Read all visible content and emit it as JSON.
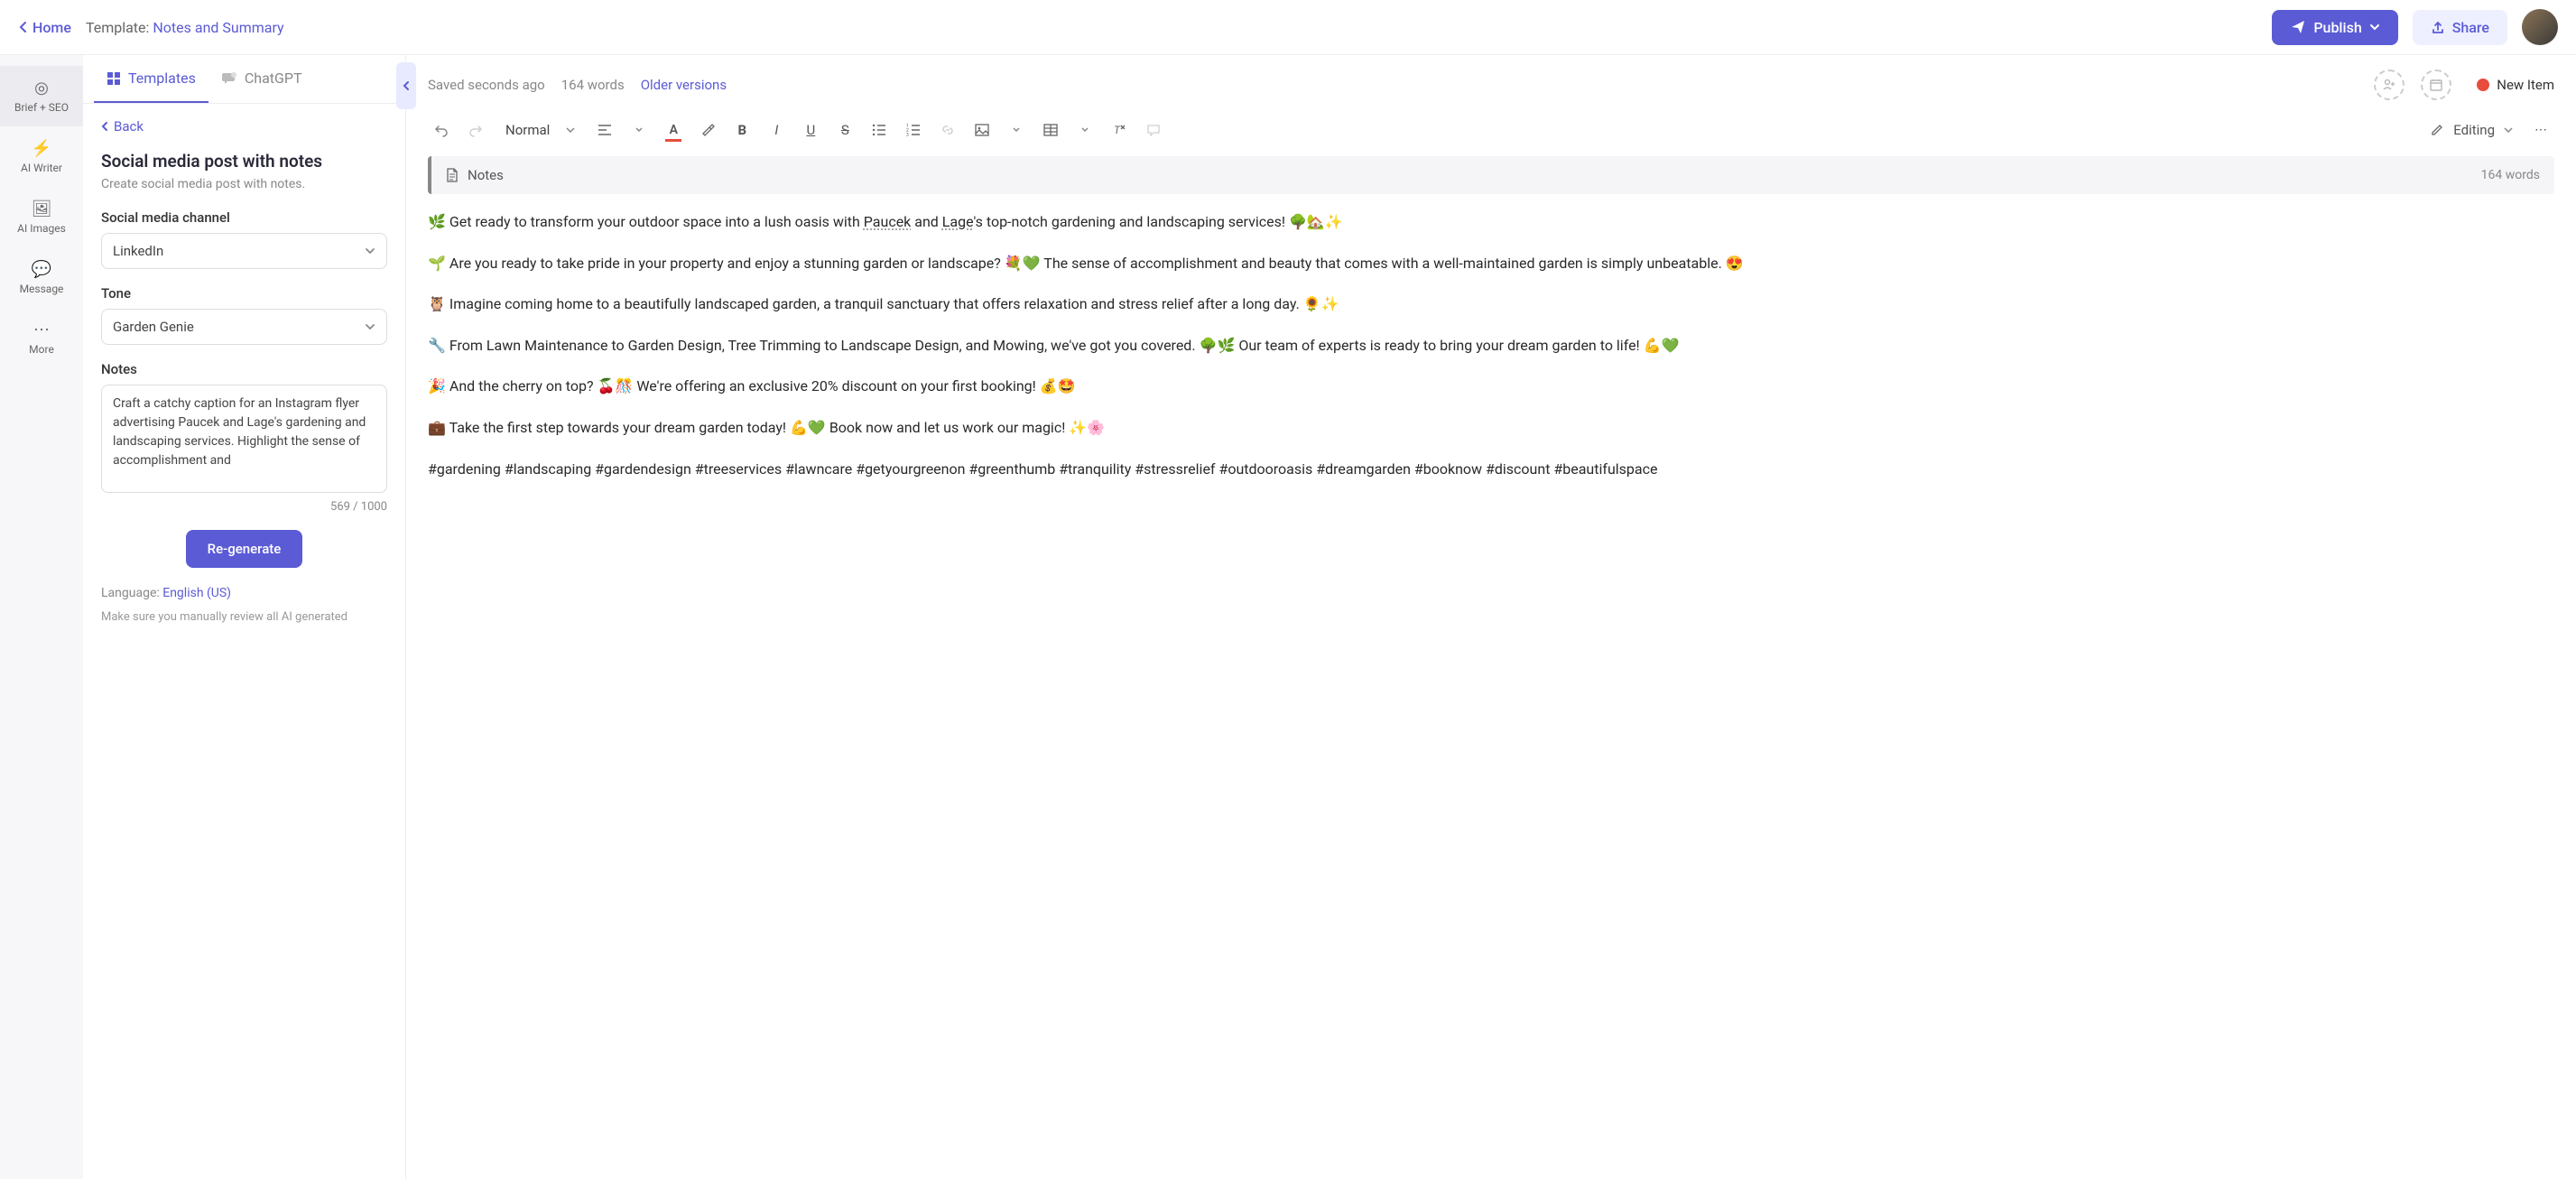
{
  "topbar": {
    "home": "Home",
    "template_prefix": "Template: ",
    "template_name": "Notes and Summary",
    "publish": "Publish",
    "share": "Share"
  },
  "leftnav": {
    "brief_seo": "Brief + SEO",
    "ai_writer": "AI Writer",
    "ai_images": "AI Images",
    "message": "Message",
    "more": "More"
  },
  "tabs": {
    "templates": "Templates",
    "chatgpt": "ChatGPT"
  },
  "panel": {
    "back": "Back",
    "title": "Social media post with notes",
    "desc": "Create social media post with notes.",
    "channel_label": "Social media channel",
    "channel_value": "LinkedIn",
    "tone_label": "Tone",
    "tone_value": "Garden Genie",
    "notes_label": "Notes",
    "notes_value": "Craft a catchy caption for an Instagram flyer advertising Paucek and Lage's gardening and landscaping services. Highlight the sense of accomplishment and",
    "char_count": "569 / 1000",
    "regenerate": "Re-generate",
    "language_prefix": "Language: ",
    "language": "English (US)",
    "disclaimer": "Make sure you manually review all AI generated"
  },
  "editor_meta": {
    "saved": "Saved seconds ago",
    "words": "164 words",
    "versions": "Older versions",
    "status": "New Item"
  },
  "toolbar": {
    "style": "Normal",
    "mode": "Editing"
  },
  "notes_block": {
    "title": "Notes",
    "words": "164 words"
  },
  "content": {
    "p1_a": "🌿 Get ready to transform your outdoor space into a lush oasis with ",
    "p1_b": "Paucek",
    "p1_c": " and ",
    "p1_d": "Lage",
    "p1_e": "'s top-notch gardening and landscaping services! 🌳🏡✨",
    "p2": "🌱 Are you ready to take pride in your property and enjoy a stunning garden or landscape? 💐💚 The sense of accomplishment and beauty that comes with a well-maintained garden is simply unbeatable. 😍",
    "p3": "🦉 Imagine coming home to a beautifully landscaped garden, a tranquil sanctuary that offers relaxation and stress relief after a long day. 🌻✨",
    "p4": "🔧 From Lawn Maintenance to Garden Design, Tree Trimming to Landscape Design, and Mowing, we've got you covered. 🌳🌿 Our team of experts is ready to bring your dream garden to life! 💪💚",
    "p5": "🎉 And the cherry on top? 🍒🎊 We're offering an exclusive 20% discount on your first booking! 💰🤩",
    "p6": "💼 Take the first step towards your dream garden today! 💪💚 Book now and let us work our magic! ✨🌸",
    "p7": "#gardening #landscaping #gardendesign #treeservices #lawncare #getyourgreenon #greenthumb #tranquility #stressrelief #outdooroasis #dreamgarden #booknow #discount #beautifulspace"
  }
}
